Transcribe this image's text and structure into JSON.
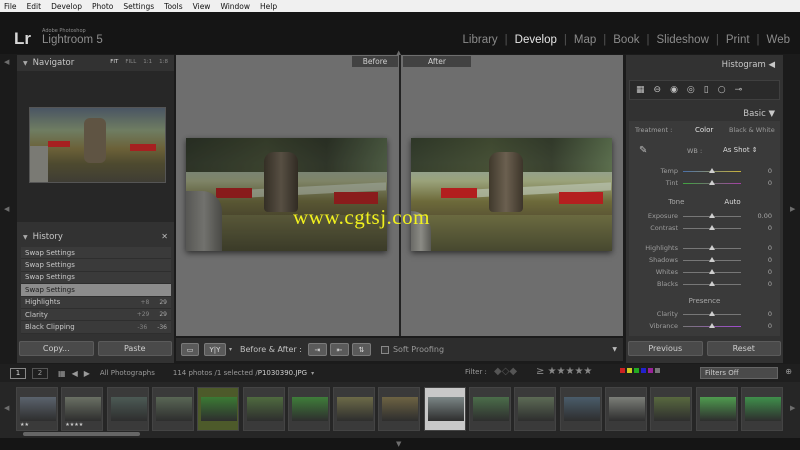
{
  "menu": [
    "File",
    "Edit",
    "Develop",
    "Photo",
    "Settings",
    "Tools",
    "View",
    "Window",
    "Help"
  ],
  "identity": {
    "logo": "Lr",
    "small": "Adobe Photoshop",
    "title": "Lightroom 5"
  },
  "modules": [
    {
      "label": "Library",
      "active": false
    },
    {
      "label": "Develop",
      "active": true
    },
    {
      "label": "Map",
      "active": false
    },
    {
      "label": "Book",
      "active": false
    },
    {
      "label": "Slideshow",
      "active": false
    },
    {
      "label": "Print",
      "active": false
    },
    {
      "label": "Web",
      "active": false
    }
  ],
  "navigator": {
    "title": "Navigator",
    "zoom": [
      "FIT",
      "FILL",
      "1:1",
      "1:8"
    ]
  },
  "history": {
    "title": "History",
    "items": [
      {
        "label": "Swap Settings",
        "a": "",
        "b": ""
      },
      {
        "label": "Swap Settings",
        "a": "",
        "b": ""
      },
      {
        "label": "Swap Settings",
        "a": "",
        "b": ""
      },
      {
        "label": "Swap Settings",
        "a": "",
        "b": ""
      },
      {
        "label": "Highlights",
        "a": "+8",
        "b": "29"
      },
      {
        "label": "Clarity",
        "a": "+29",
        "b": "29"
      },
      {
        "label": "Black Clipping",
        "a": "-36",
        "b": "-36"
      }
    ],
    "selected_index": 3
  },
  "left_buttons": {
    "copy": "Copy...",
    "paste": "Paste"
  },
  "view": {
    "before": "Before",
    "after": "After"
  },
  "watermark": "www.cgtsj.com",
  "toolbar": {
    "yy": "Y|Y",
    "ba_label": "Before & After :",
    "soft_proofing": "Soft Proofing"
  },
  "histogram": {
    "title": "Histogram"
  },
  "basic": {
    "title": "Basic",
    "treatment_label": "Treatment :",
    "treatment_color": "Color",
    "treatment_bw": "Black & White",
    "wb_label": "WB :",
    "wb_value": "As Shot",
    "tone_label": "Tone",
    "auto": "Auto",
    "presence_label": "Presence",
    "sliders_wb": [
      {
        "label": "Temp",
        "value": "0",
        "pos": 0.5
      },
      {
        "label": "Tint",
        "value": "0",
        "pos": 0.5
      }
    ],
    "sliders_tone": [
      {
        "label": "Exposure",
        "value": "0.00",
        "pos": 0.5
      },
      {
        "label": "Contrast",
        "value": "0",
        "pos": 0.5
      },
      {
        "label": "Highlights",
        "value": "0",
        "pos": 0.5
      },
      {
        "label": "Shadows",
        "value": "0",
        "pos": 0.5
      },
      {
        "label": "Whites",
        "value": "0",
        "pos": 0.5
      },
      {
        "label": "Blacks",
        "value": "0",
        "pos": 0.5
      }
    ],
    "sliders_presence": [
      {
        "label": "Clarity",
        "value": "0",
        "pos": 0.5
      },
      {
        "label": "Vibrance",
        "value": "0",
        "pos": 0.5
      }
    ]
  },
  "right_buttons": {
    "previous": "Previous",
    "reset": "Reset"
  },
  "filmbar": {
    "page1": "1",
    "page2": "2",
    "source": "All Photographs",
    "count": "114 photos /1 selected /",
    "file": "P1030390.JPG",
    "filter_label": "Filter :",
    "filters_off": "Filters Off"
  },
  "filmstrip": {
    "colors": [
      "#5b636d",
      "#6a7064",
      "#4c5a55",
      "#596655",
      "#3b7a34",
      "#4f6a3f",
      "#3f7d3a",
      "#6c6a48",
      "#6d6343",
      "#7b8686",
      "#4b6d4a",
      "#5c6a55",
      "#4a5c6a",
      "#7b7e78",
      "#58683f",
      "#4f9b4f",
      "#3f8f4b"
    ],
    "stars": [
      "★★",
      "★★★★"
    ],
    "selected_index": 9
  }
}
